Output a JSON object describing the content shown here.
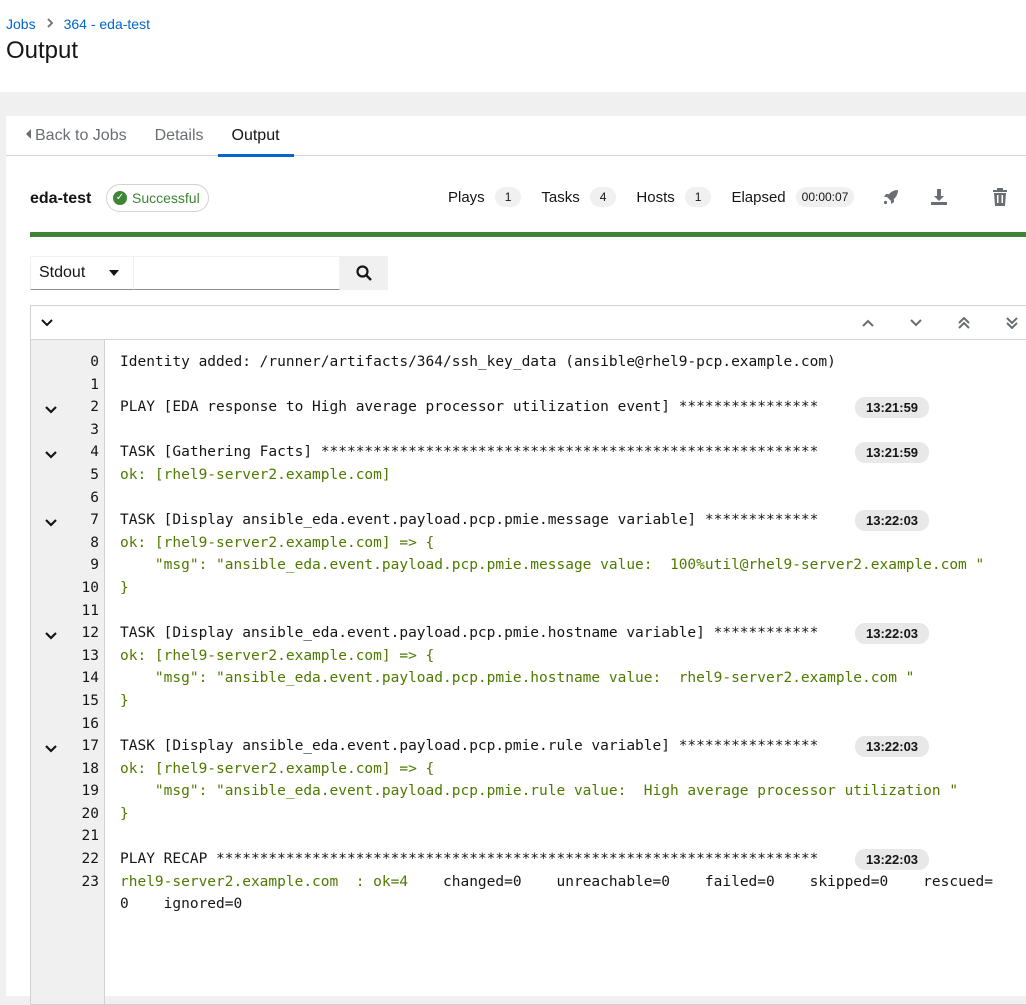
{
  "breadcrumb": {
    "jobs": "Jobs",
    "current": "364 - eda-test"
  },
  "page_title": "Output",
  "tabs": {
    "back": "Back to Jobs",
    "details": "Details",
    "output": "Output"
  },
  "job": {
    "name": "eda-test",
    "status": "Successful",
    "plays_label": "Plays",
    "plays": "1",
    "tasks_label": "Tasks",
    "tasks": "4",
    "hosts_label": "Hosts",
    "hosts": "1",
    "elapsed_label": "Elapsed",
    "elapsed": "00:00:07",
    "progress_percent": 100
  },
  "search": {
    "select_value": "Stdout",
    "placeholder": ""
  },
  "output_lines": [
    {
      "n": "0",
      "t": "Identity added: /runner/artifacts/364/ssh_key_data (ansible@rhel9-pcp.example.com)",
      "green": false,
      "collapse": false,
      "time": ""
    },
    {
      "n": "1",
      "t": "",
      "green": false,
      "collapse": false,
      "time": ""
    },
    {
      "n": "2",
      "t": "PLAY [EDA response to High average processor utilization event] ****************",
      "green": false,
      "collapse": true,
      "time": "13:21:59"
    },
    {
      "n": "3",
      "t": "",
      "green": false,
      "collapse": false,
      "time": ""
    },
    {
      "n": "4",
      "t": "TASK [Gathering Facts] *********************************************************",
      "green": false,
      "collapse": true,
      "time": "13:21:59"
    },
    {
      "n": "5",
      "t": "ok: [rhel9-server2.example.com]",
      "green": true,
      "collapse": false,
      "time": ""
    },
    {
      "n": "6",
      "t": "",
      "green": false,
      "collapse": false,
      "time": ""
    },
    {
      "n": "7",
      "t": "TASK [Display ansible_eda.event.payload.pcp.pmie.message variable] *************",
      "green": false,
      "collapse": true,
      "time": "13:22:03"
    },
    {
      "n": "8",
      "t": "ok: [rhel9-server2.example.com] => {",
      "green": true,
      "collapse": false,
      "time": ""
    },
    {
      "n": "9",
      "t": "    \"msg\": \"ansible_eda.event.payload.pcp.pmie.message value:  100%util@rhel9-server2.example.com \"",
      "green": true,
      "collapse": false,
      "time": ""
    },
    {
      "n": "10",
      "t": "}",
      "green": true,
      "collapse": false,
      "time": ""
    },
    {
      "n": "11",
      "t": "",
      "green": false,
      "collapse": false,
      "time": ""
    },
    {
      "n": "12",
      "t": "TASK [Display ansible_eda.event.payload.pcp.pmie.hostname variable] ************",
      "green": false,
      "collapse": true,
      "time": "13:22:03"
    },
    {
      "n": "13",
      "t": "ok: [rhel9-server2.example.com] => {",
      "green": true,
      "collapse": false,
      "time": ""
    },
    {
      "n": "14",
      "t": "    \"msg\": \"ansible_eda.event.payload.pcp.pmie.hostname value:  rhel9-server2.example.com \"",
      "green": true,
      "collapse": false,
      "time": ""
    },
    {
      "n": "15",
      "t": "}",
      "green": true,
      "collapse": false,
      "time": ""
    },
    {
      "n": "16",
      "t": "",
      "green": false,
      "collapse": false,
      "time": ""
    },
    {
      "n": "17",
      "t": "TASK [Display ansible_eda.event.payload.pcp.pmie.rule variable] ****************",
      "green": false,
      "collapse": true,
      "time": "13:22:03"
    },
    {
      "n": "18",
      "t": "ok: [rhel9-server2.example.com] => {",
      "green": true,
      "collapse": false,
      "time": ""
    },
    {
      "n": "19",
      "t": "    \"msg\": \"ansible_eda.event.payload.pcp.pmie.rule value:  High average processor utilization \"",
      "green": true,
      "collapse": false,
      "time": ""
    },
    {
      "n": "20",
      "t": "}",
      "green": true,
      "collapse": false,
      "time": ""
    },
    {
      "n": "21",
      "t": "",
      "green": false,
      "collapse": false,
      "time": ""
    },
    {
      "n": "22",
      "t": "PLAY RECAP *********************************************************************",
      "green": false,
      "collapse": false,
      "time": "13:22:03"
    }
  ],
  "recap": {
    "n": "23",
    "host": "rhel9-server2.example.com",
    "ok": "  : ok=4",
    "rest": "    changed=0    unreachable=0    failed=0    skipped=0    rescued=",
    "wrap": "0    ignored=0"
  },
  "colors": {
    "accent": "#0066cc",
    "success": "#3e8635",
    "ok_text": "#4e7a00"
  }
}
